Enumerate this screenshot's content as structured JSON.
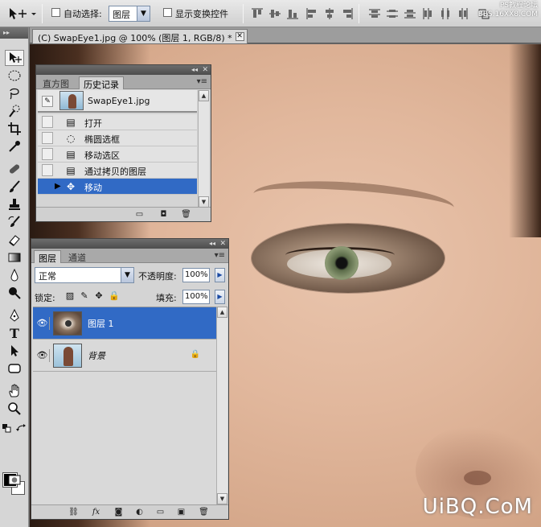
{
  "options_bar": {
    "auto_select_label": "自动选择:",
    "auto_select_value": "图层",
    "show_transform_label": "显示变换控件",
    "watermark_top": "PS教程论坛\nBBS.16XX8.COM"
  },
  "document": {
    "tab_title": "(C) SwapEye1.jpg @ 100% (图层 1, RGB/8) *",
    "watermark": "UiBQ.CoM"
  },
  "history_panel": {
    "tabs": [
      "直方图",
      "历史记录"
    ],
    "active_tab": "历史记录",
    "snapshot_label": "SwapEye1.jpg",
    "steps": [
      {
        "label": "打开",
        "icon": "document-icon"
      },
      {
        "label": "椭圆选框",
        "icon": "ellipse-marquee-icon"
      },
      {
        "label": "移动选区",
        "icon": "document-icon"
      },
      {
        "label": "通过拷贝的图层",
        "icon": "document-icon"
      },
      {
        "label": "移动",
        "icon": "move-icon",
        "selected": true
      }
    ]
  },
  "layers_panel": {
    "tabs": [
      "图层",
      "通道"
    ],
    "active_tab": "图层",
    "blend_mode": "正常",
    "opacity_label": "不透明度:",
    "opacity_value": "100%",
    "lock_label": "锁定:",
    "fill_label": "填充:",
    "fill_value": "100%",
    "layers": [
      {
        "name": "图层 1",
        "selected": true,
        "visible": true
      },
      {
        "name": "背景",
        "selected": false,
        "visible": true,
        "locked": true
      }
    ]
  },
  "colors": {
    "selection_blue": "#316ac5",
    "panel_bg": "#d4d4d4"
  }
}
